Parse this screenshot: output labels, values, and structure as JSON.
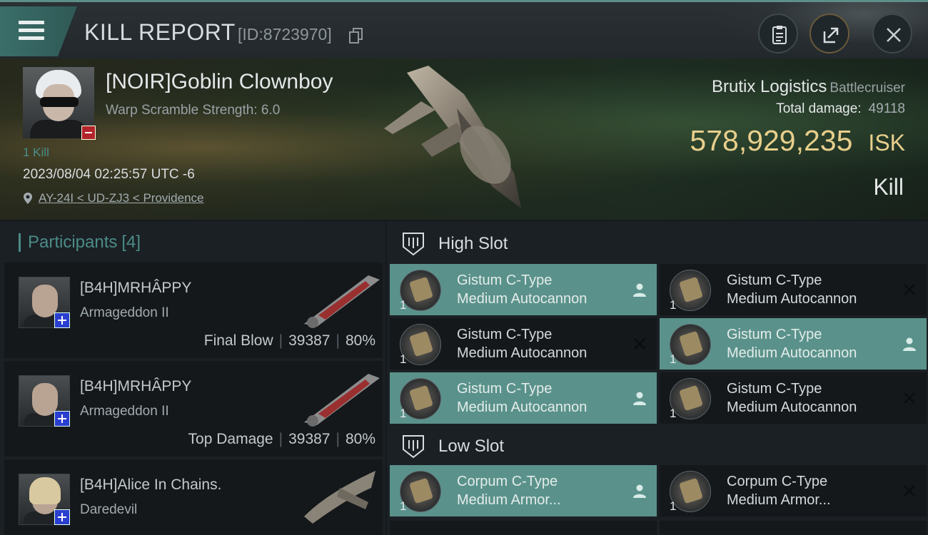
{
  "header": {
    "title": "KILL REPORT",
    "report_id": "[ID:8723970]",
    "icons": [
      "menu-icon",
      "clipboard-icon",
      "share-icon",
      "close-icon"
    ]
  },
  "victim": {
    "name": "[NOIR]Goblin Clownboy",
    "warp_scramble": "Warp Scramble Strength: 6.0",
    "kills": "1 Kill",
    "timestamp": "2023/08/04 02:25:57 UTC -6",
    "location": "AY-24I < UD-ZJ3 < Providence",
    "ship_name": "Brutix Logistics",
    "ship_class": "Battlecruiser",
    "total_damage_label": "Total damage:",
    "total_damage": "49118",
    "isk_value": "578,929,235",
    "isk_unit": "ISK",
    "kill_type": "Kill"
  },
  "participants": {
    "label": "Participants",
    "count": "[4]",
    "items": [
      {
        "name": "[B4H]MRHÂPPY",
        "ship": "Armageddon II",
        "tag": "Final Blow",
        "damage": "39387",
        "percent": "80%"
      },
      {
        "name": "[B4H]MRHÂPPY",
        "ship": "Armageddon II",
        "tag": "Top Damage",
        "damage": "39387",
        "percent": "80%"
      },
      {
        "name": "[B4H]Alice In Chains.",
        "ship": "Daredevil",
        "tag": "",
        "damage": "",
        "percent": ""
      }
    ]
  },
  "fitting": {
    "high_slot_label": "High Slot",
    "low_slot_label": "Low Slot",
    "high_modules": [
      {
        "line1": "Gistum C-Type",
        "line2": "Medium Autocannon",
        "qty": "1",
        "status": "dropped"
      },
      {
        "line1": "Gistum C-Type",
        "line2": "Medium Autocannon",
        "qty": "1",
        "status": "destroyed"
      },
      {
        "line1": "Gistum C-Type",
        "line2": "Medium Autocannon",
        "qty": "1",
        "status": "destroyed"
      },
      {
        "line1": "Gistum C-Type",
        "line2": "Medium Autocannon",
        "qty": "1",
        "status": "dropped"
      },
      {
        "line1": "Gistum C-Type",
        "line2": "Medium Autocannon",
        "qty": "1",
        "status": "dropped"
      },
      {
        "line1": "Gistum C-Type",
        "line2": "Medium Autocannon",
        "qty": "1",
        "status": "destroyed"
      }
    ],
    "low_modules": [
      {
        "line1": "Corpum C-Type",
        "line2": "Medium Armor...",
        "qty": "1",
        "status": "dropped"
      },
      {
        "line1": "Corpum C-Type",
        "line2": "Medium Armor...",
        "qty": "1",
        "status": "destroyed"
      }
    ]
  },
  "colors": {
    "accent_teal": "#5a928b",
    "isk_gold": "#e8cf8c",
    "background": "#1b2024",
    "card_dark": "#14181b"
  }
}
